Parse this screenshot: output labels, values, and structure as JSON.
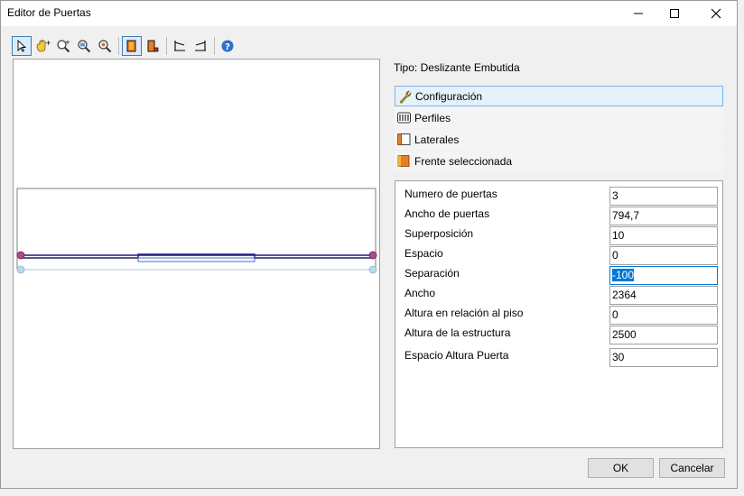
{
  "window": {
    "title": "Editor de Puertas"
  },
  "toolbar": {
    "tools": [
      "select-pointer-icon",
      "pan-hand-icon",
      "zoom-window-icon",
      "zoom-in-icon",
      "zoom-out-icon",
      "door-front-icon",
      "door-side-icon",
      "view-left-icon",
      "view-right-icon",
      "help-icon"
    ]
  },
  "info": {
    "tipo": "Tipo: Deslizante Embutida"
  },
  "sections": [
    {
      "label": "Configuración",
      "icon": "wrench-icon",
      "active": true
    },
    {
      "label": "Perfiles",
      "icon": "profiles-icon",
      "active": false
    },
    {
      "label": "Laterales",
      "icon": "laterals-icon",
      "active": false
    },
    {
      "label": "Frente seleccionada",
      "icon": "front-icon",
      "active": false
    }
  ],
  "properties": [
    {
      "label": "Numero de puertas",
      "value": "3"
    },
    {
      "label": "Ancho de puertas",
      "value": "794,7"
    },
    {
      "label": "Superposición",
      "value": "10"
    },
    {
      "label": "Espacio",
      "value": "0"
    },
    {
      "label": "Separación",
      "value": "-100"
    },
    {
      "label": "Ancho",
      "value": "2364"
    },
    {
      "label": "Altura en relación al piso",
      "value": "0"
    },
    {
      "label": "Altura de la estructura",
      "value": "2500"
    },
    {
      "label": "Espacio Altura Puerta",
      "value": "30"
    }
  ],
  "buttons": {
    "ok": "OK",
    "cancel": "Cancelar"
  }
}
